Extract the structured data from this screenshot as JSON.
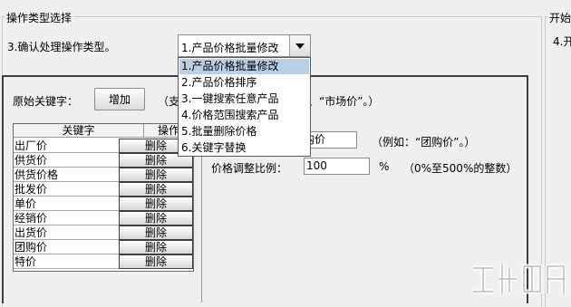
{
  "left_group": {
    "title": "操作类型选择"
  },
  "right_group": {
    "title": "开始",
    "step_text": "4.开"
  },
  "step": {
    "label": "3.确认处理操作类型。"
  },
  "combo": {
    "value": "1.产品价格批量修改",
    "options": [
      "1.产品价格批量修改",
      "2.产品价格排序",
      "3.一键搜索任意产品",
      "4.价格范围搜索产品",
      "5.批量删除价格",
      "6.关键字替换"
    ],
    "selected_index": 0,
    "expanded": true
  },
  "keyword": {
    "label": "原始关键字：",
    "add_button": "增加",
    "hint_left": "（支",
    "hint_right": "、“市场价”。）"
  },
  "table": {
    "headers": {
      "keyword": "关键字",
      "operation": "操作"
    },
    "rows": [
      {
        "keyword": "出厂价",
        "action": "删除"
      },
      {
        "keyword": "供货价",
        "action": "删除"
      },
      {
        "keyword": "供货价格",
        "action": "删除"
      },
      {
        "keyword": "批发价",
        "action": "删除"
      },
      {
        "keyword": "单价",
        "action": "删除"
      },
      {
        "keyword": "经销价",
        "action": "删除"
      },
      {
        "keyword": "出货价",
        "action": "删除"
      },
      {
        "keyword": "团购价",
        "action": "删除"
      },
      {
        "keyword": "特价",
        "action": "删除"
      }
    ]
  },
  "new_prefix": {
    "value": "购价",
    "example": "（例如：“团购价”。）"
  },
  "ratio": {
    "label": "价格调整比例：",
    "value": "100",
    "unit": "%",
    "range_hint": "（0%至500%的整数）"
  },
  "watermark": {
    "icon": "download-site-logo"
  },
  "colors": {
    "selection": "#b8cfe5",
    "panel_border": "#3d3d3d",
    "background": "#efefef"
  }
}
